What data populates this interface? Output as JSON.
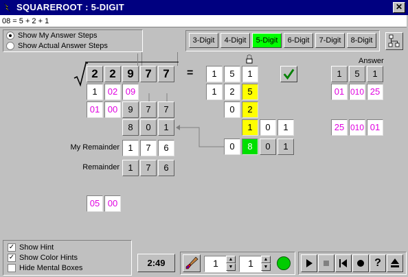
{
  "window": {
    "title": "SQUAREROOT : 5-DIGIT",
    "close": "✕"
  },
  "equation": "08 = 5 + 2 + 1",
  "options": {
    "show_my_steps": "Show My Answer Steps",
    "show_actual_steps": "Show Actual Answer Steps"
  },
  "digits": [
    "3-Digit",
    "4-Digit",
    "5-Digit",
    "6-Digit",
    "7-Digit",
    "8-Digit"
  ],
  "active_digits": "5-Digit",
  "problem": {
    "radicand": [
      "2",
      "2",
      "9",
      "7",
      "7"
    ],
    "equals": "=",
    "result": [
      "1",
      "5",
      "1"
    ],
    "row1_left": [
      "1",
      "02",
      "09"
    ],
    "row2_left": [
      "01",
      "00",
      "9",
      "7",
      "7"
    ],
    "row3_left": [
      "8",
      "0",
      "1"
    ],
    "my_remainder_label": "My Remainder",
    "my_remainder": [
      "1",
      "7",
      "6"
    ],
    "remainder_label": "Remainder",
    "remainder": [
      "1",
      "7",
      "6"
    ],
    "bottom_left": [
      "05",
      "00"
    ],
    "mid_row1": [
      "1",
      "2",
      "5"
    ],
    "mid_row2": [
      "0",
      "2"
    ],
    "mid_row3": [
      "1",
      "0",
      "1"
    ],
    "mid_row4": [
      "0",
      "8",
      "0",
      "1"
    ]
  },
  "answer": {
    "label": "Answer",
    "digits": [
      "1",
      "5",
      "1"
    ],
    "row1": [
      "01",
      "010",
      "25"
    ],
    "row2": [
      "25",
      "010",
      "01"
    ]
  },
  "checks": {
    "show_hint": "Show Hint",
    "show_color_hints": "Show Color Hints",
    "hide_mental": "Hide Mental Boxes"
  },
  "timer": "2:49",
  "spin1": "1",
  "spin2": "1",
  "status_color": "#00cc00"
}
